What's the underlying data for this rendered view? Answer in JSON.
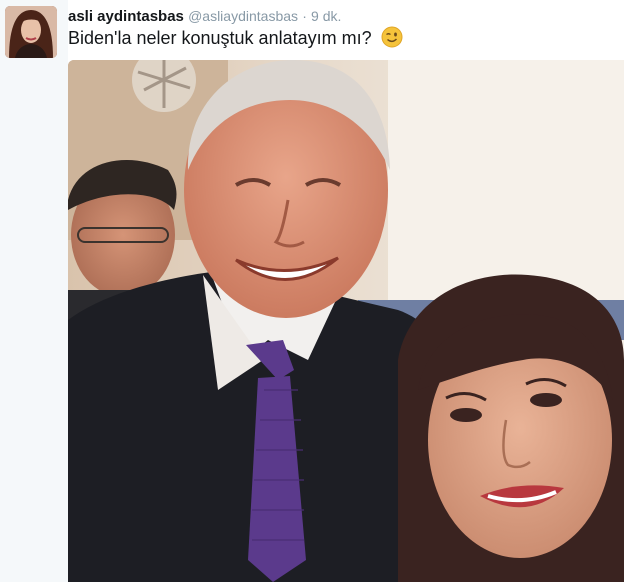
{
  "tweet": {
    "author_name": "asli aydintasbas",
    "author_handle": "@asliaydintasbas",
    "separator": "·",
    "timestamp": "9 dk.",
    "text": "Biden'la neler konuştuk anlatayım mı?",
    "emoji_icon": "winking-face-emoji"
  },
  "colors": {
    "name": "#14171a",
    "muted": "#8899a6",
    "rail": "#f5f8fa",
    "tie": "#5b3a8c"
  }
}
